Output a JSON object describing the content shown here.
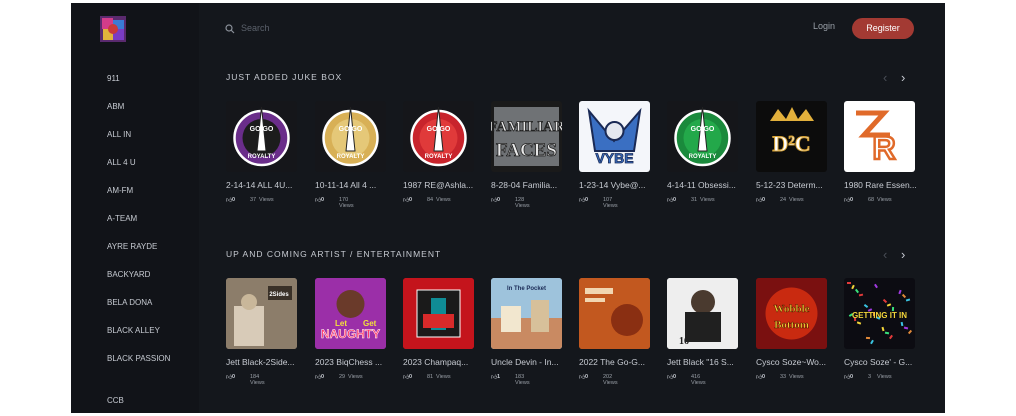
{
  "sidebar": {
    "items": [
      "911",
      "ABM",
      "ALL IN",
      "ALL 4 U",
      "AM-FM",
      "A-TEAM",
      "AYRE RAYDE",
      "BACKYARD",
      "BELA DONA",
      "BLACK ALLEY",
      "BLACK PASSION",
      "CCB"
    ]
  },
  "header": {
    "search_placeholder": "Search",
    "login": "Login",
    "register": "Register"
  },
  "sections": [
    {
      "title": "JUST ADDED JUKE BOX",
      "cards": [
        {
          "title": "2-14-14 ALL 4U...",
          "likes": "0",
          "views": "37",
          "views_label": "Views",
          "art": "royalty-purple"
        },
        {
          "title": "10-11-14 All 4 ...",
          "likes": "0",
          "views": "170",
          "views_label": "Views",
          "art": "royalty-gold"
        },
        {
          "title": "1987 RE@Ashla...",
          "likes": "0",
          "views": "84",
          "views_label": "Views",
          "art": "royalty-red"
        },
        {
          "title": "8-28-04 Familia...",
          "likes": "0",
          "views": "128",
          "views_label": "Views",
          "art": "familiar-faces"
        },
        {
          "title": "1-23-14 Vybe@...",
          "likes": "0",
          "views": "107",
          "views_label": "Views",
          "art": "vybe"
        },
        {
          "title": "4-14-11 Obsessi...",
          "likes": "0",
          "views": "31",
          "views_label": "Views",
          "art": "royalty-green"
        },
        {
          "title": "5-12-23 Determ...",
          "likes": "0",
          "views": "24",
          "views_label": "Views",
          "art": "d2c"
        },
        {
          "title": "1980 Rare Essen...",
          "likes": "0",
          "views": "68",
          "views_label": "Views",
          "art": "rare-essence"
        }
      ]
    },
    {
      "title": "UP AND COMING ARTIST / ENTERTAINMENT",
      "cards": [
        {
          "title": "Jett Black-2Side...",
          "likes": "0",
          "views": "184",
          "views_label": "Views",
          "art": "jett-2sides"
        },
        {
          "title": "2023 BiqChess ...",
          "likes": "0",
          "views": "29",
          "views_label": "Views",
          "art": "naughty"
        },
        {
          "title": "2023 Champaq...",
          "likes": "0",
          "views": "81",
          "views_label": "Views",
          "art": "champagne"
        },
        {
          "title": "Uncle Devin - In...",
          "likes": "1",
          "views": "183",
          "views_label": "Views",
          "art": "uncle-devin"
        },
        {
          "title": "2022 The Go-G...",
          "likes": "0",
          "views": "202",
          "views_label": "Views",
          "art": "go-go"
        },
        {
          "title": "Jett Black \"16 S...",
          "likes": "0",
          "views": "416",
          "views_label": "Views",
          "art": "jett-16"
        },
        {
          "title": "Cysco Soze~Wo...",
          "likes": "0",
          "views": "33",
          "views_label": "Views",
          "art": "wobble"
        },
        {
          "title": "Cysco Soze' - G...",
          "likes": "0",
          "views": "3",
          "views_label": "Views",
          "art": "getting-it-in"
        }
      ]
    }
  ],
  "colors": {
    "page_bg": "#14171c",
    "sidebar_bg": "#111318",
    "accent": "#a33a33",
    "text": "#c7cbd2"
  }
}
